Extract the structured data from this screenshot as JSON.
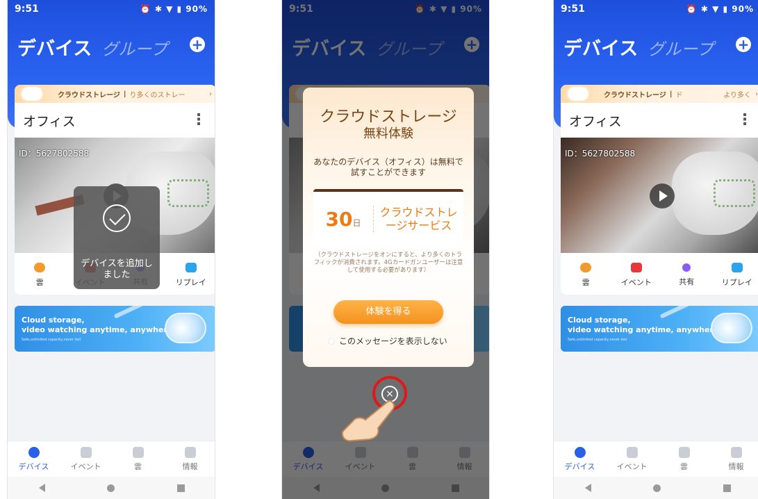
{
  "status": {
    "time": "9:51",
    "battery": "90%"
  },
  "header": {
    "devices_tab": "デバイス",
    "groups_tab": "グループ"
  },
  "banner": {
    "title": "クラウドストレージ",
    "separator": "|",
    "subtitle_1": "り多くのストレー",
    "subtitle_3": "ド",
    "more_3": "より多く"
  },
  "card": {
    "name": "オフィス",
    "device_id": "ID：5627802588"
  },
  "actions": [
    "雲",
    "イベント",
    "共有",
    "リプレイ"
  ],
  "ad": {
    "line1": "Cloud storage,",
    "line2": "video watching anytime, anywhere",
    "line3": "Safe,unlimited capacity,never lost"
  },
  "tabs": [
    "デバイス",
    "イベント",
    "雲",
    "情報"
  ],
  "toast": {
    "text": "デバイスを追加しました"
  },
  "dialog": {
    "title": "クラウドストレージ",
    "subtitle": "無料体験",
    "desc": "あなたのデバイス（オフィス）は無料で試すことができます",
    "days": "30",
    "day_unit": "日",
    "service": "クラウドストレージサービス",
    "note": "（クラウドストレージをオンにすると、より多くのトラフィックが消費されます。4Gカードガンユーザーは注意して使用する必要があります）",
    "button": "体験を得る",
    "checkbox": "このメッセージを表示しない",
    "close": "×"
  },
  "colors": {
    "brand_blue": "#2a5fe8",
    "accent_orange": "#f07a12",
    "highlight_red": "#e01818"
  }
}
